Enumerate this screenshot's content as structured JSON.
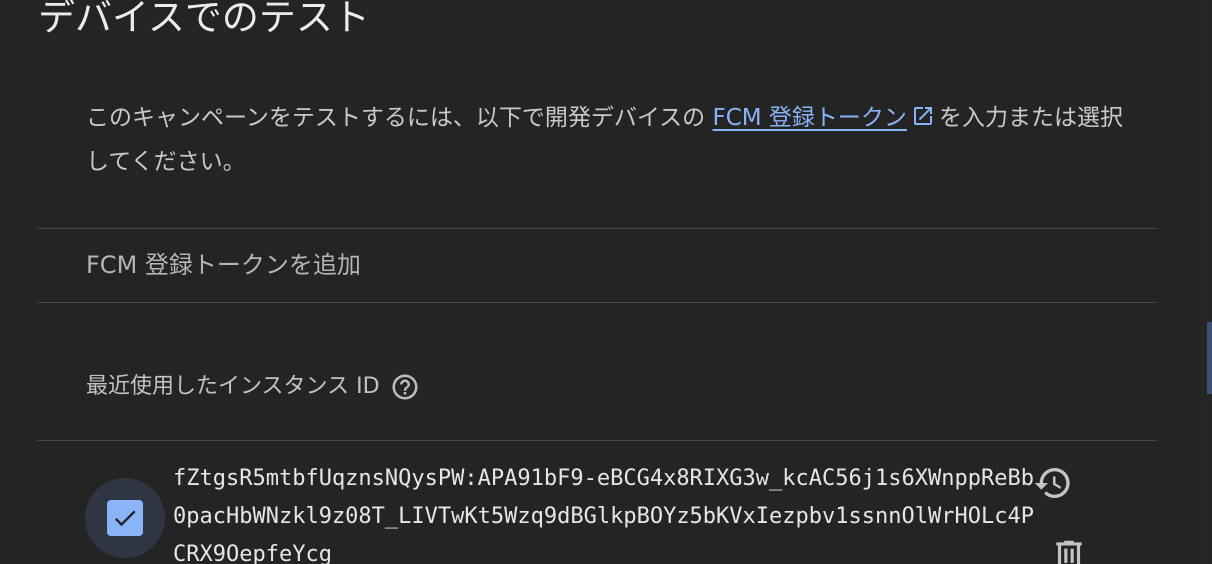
{
  "section": {
    "title": "デバイスでのテスト",
    "description_prefix": "このキャンペーンをテストするには、以下で開発デバイスの ",
    "description_link": "FCM 登録トークン",
    "description_suffix": "を入力または選択してください。"
  },
  "add_token": {
    "placeholder": "FCM 登録トークンを追加",
    "value": ""
  },
  "recent": {
    "label": "最近使用したインスタンス ID",
    "help_icon": "help-circle-icon",
    "items": [
      {
        "checked": true,
        "token": "fZtgsR5mtbfUqznsNQysPW:APA91bF9-eBCG4x8RIXG3w_kcAC56j1s6XWnppReBb0pacHbWNzkl9z08T_LIVTwKt5Wzq9dBGlkpBOYz5bKVxIezpbv1ssnnOlWrHOLc4PCRX9OepfeYcg",
        "history_icon": "history-icon",
        "delete_icon": "trash-icon"
      }
    ]
  },
  "colors": {
    "background": "#242424",
    "accent": "#8ab4f8",
    "divider": "#474747"
  }
}
